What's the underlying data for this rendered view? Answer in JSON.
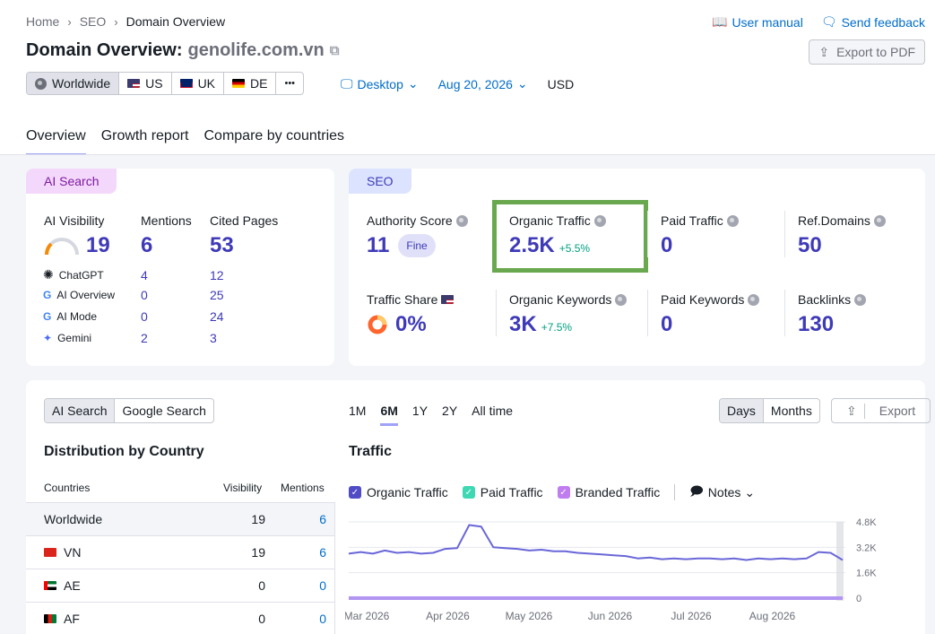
{
  "breadcrumb": [
    "Home",
    "SEO",
    "Domain Overview"
  ],
  "header": {
    "user_manual": "User manual",
    "send_feedback": "Send feedback",
    "title_prefix": "Domain Overview:",
    "domain": "genolife.com.vn",
    "export_pdf": "Export to PDF"
  },
  "geo": {
    "options": [
      "Worldwide",
      "US",
      "UK",
      "DE"
    ],
    "more": "•••",
    "device": "Desktop",
    "date": "Aug 20, 2026",
    "currency": "USD"
  },
  "tabs": [
    "Overview",
    "Growth report",
    "Compare by countries"
  ],
  "ai_card": {
    "label": "AI Search",
    "col_visibility": "AI Visibility",
    "col_mentions": "Mentions",
    "col_cited": "Cited Pages",
    "visibility": "19",
    "mentions": "6",
    "cited": "53",
    "rows": [
      {
        "name": "ChatGPT",
        "mentions": "4",
        "cited": "12"
      },
      {
        "name": "AI Overview",
        "mentions": "0",
        "cited": "25"
      },
      {
        "name": "AI Mode",
        "mentions": "0",
        "cited": "24"
      },
      {
        "name": "Gemini",
        "mentions": "2",
        "cited": "3"
      }
    ]
  },
  "seo_card": {
    "label": "SEO",
    "authority_label": "Authority Score",
    "authority_value": "11",
    "authority_badge": "Fine",
    "organic_label": "Organic Traffic",
    "organic_value": "2.5K",
    "organic_delta": "+5.5%",
    "paid_label": "Paid Traffic",
    "paid_value": "0",
    "ref_label": "Ref.Domains",
    "ref_value": "50",
    "share_label": "Traffic Share",
    "share_value": "0%",
    "okw_label": "Organic Keywords",
    "okw_value": "3K",
    "okw_delta": "+7.5%",
    "pkw_label": "Paid Keywords",
    "pkw_value": "0",
    "backlinks_label": "Backlinks",
    "backlinks_value": "130"
  },
  "lower": {
    "search_toggle": [
      "AI Search",
      "Google Search"
    ],
    "dist_title": "Distribution by Country",
    "col_countries": "Countries",
    "col_visibility": "Visibility",
    "col_mentions": "Mentions",
    "rows": [
      {
        "country": "Worldwide",
        "visibility": "19",
        "mentions": "6"
      },
      {
        "country": "VN",
        "visibility": "19",
        "mentions": "6"
      },
      {
        "country": "AE",
        "visibility": "0",
        "mentions": "0"
      },
      {
        "country": "AF",
        "visibility": "0",
        "mentions": "0"
      }
    ],
    "periods": [
      "1M",
      "6M",
      "1Y",
      "2Y",
      "All time"
    ],
    "granularity": [
      "Days",
      "Months"
    ],
    "export": "Export",
    "traffic_title": "Traffic",
    "legend": [
      "Organic Traffic",
      "Paid Traffic",
      "Branded Traffic"
    ],
    "notes": "Notes"
  },
  "colors": {
    "accent": "#3e3ab8",
    "link": "#006dca",
    "organic_line": "#6a67d8",
    "highlight_border": "#6aa84f"
  },
  "chart_data": {
    "type": "line",
    "title": "Traffic",
    "x_ticks": [
      "Mar 2026",
      "Apr 2026",
      "May 2026",
      "Jun 2026",
      "Jul 2026",
      "Aug 2026"
    ],
    "y_ticks": [
      "4.8K",
      "3.2K",
      "1.6K",
      "0"
    ],
    "ylim": [
      0,
      4800
    ],
    "series": [
      {
        "name": "Organic Traffic",
        "values": [
          2800,
          2900,
          2800,
          3000,
          2850,
          2900,
          2800,
          2850,
          3100,
          3150,
          4600,
          4500,
          3200,
          3150,
          3100,
          3000,
          3050,
          2950,
          2950,
          2850,
          2800,
          2750,
          2700,
          2650,
          2500,
          2550,
          2450,
          2500,
          2450,
          2500,
          2500,
          2450,
          2500,
          2400,
          2500,
          2450,
          2500,
          2450,
          2500,
          2900,
          2850,
          2400
        ]
      },
      {
        "name": "Paid Traffic",
        "values": [
          0,
          0,
          0,
          0,
          0,
          0,
          0,
          0,
          0,
          0,
          0,
          0,
          0,
          0,
          0,
          0,
          0,
          0,
          0,
          0,
          0,
          0,
          0,
          0,
          0,
          0,
          0,
          0,
          0,
          0,
          0,
          0,
          0,
          0,
          0,
          0,
          0,
          0,
          0,
          0,
          0,
          0
        ]
      }
    ]
  }
}
